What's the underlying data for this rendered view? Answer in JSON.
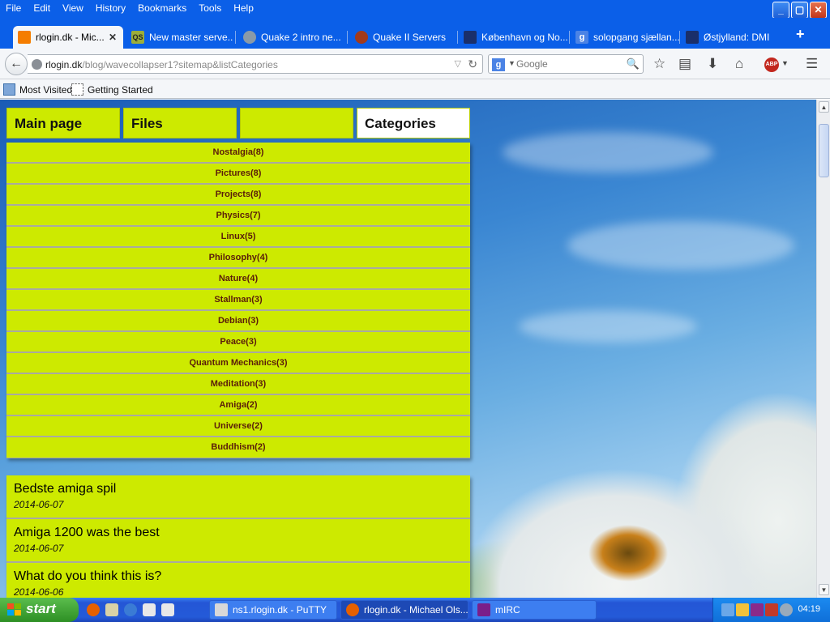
{
  "menubar": {
    "items": [
      "File",
      "Edit",
      "View",
      "History",
      "Bookmarks",
      "Tools",
      "Help"
    ]
  },
  "tabs": [
    {
      "label": "rlogin.dk - Mic...",
      "active": true
    },
    {
      "label": "New master serve..."
    },
    {
      "label": "Quake 2 intro ne..."
    },
    {
      "label": "Quake II Servers"
    },
    {
      "label": "København og No..."
    },
    {
      "label": "solopgang sjællan..."
    },
    {
      "label": "Østjylland: DMI"
    }
  ],
  "navbar": {
    "url_host": "rlogin.dk",
    "url_path": "/blog/wavecollapser1?sitemap&listCategories",
    "search_placeholder": "Google"
  },
  "bookmarks": [
    "Most Visited",
    "Getting Started"
  ],
  "site_nav": {
    "main_page": "Main page",
    "files": "Files",
    "blank": "",
    "categories": "Categories"
  },
  "categories": [
    "Nostalgia(8)",
    "Pictures(8)",
    "Projects(8)",
    "Physics(7)",
    "Linux(5)",
    "Philosophy(4)",
    "Nature(4)",
    "Stallman(3)",
    "Debian(3)",
    "Peace(3)",
    "Quantum Mechanics(3)",
    "Meditation(3)",
    "Amiga(2)",
    "Universe(2)",
    "Buddhism(2)"
  ],
  "posts": [
    {
      "title": "Bedste amiga spil",
      "date": "2014-06-07"
    },
    {
      "title": "Amiga 1200 was the best",
      "date": "2014-06-07"
    },
    {
      "title": "What do you think this is?",
      "date": "2014-06-06"
    }
  ],
  "taskbar": {
    "start": "start",
    "buttons": [
      "ns1.rlogin.dk - PuTTY",
      "rlogin.dk - Michael Ols...",
      "mIRC"
    ],
    "clock": "04:19"
  },
  "colors": {
    "accent_green": "#cdea00",
    "category_text": "#5a1d0a",
    "xp_blue": "#0b5fe8"
  }
}
